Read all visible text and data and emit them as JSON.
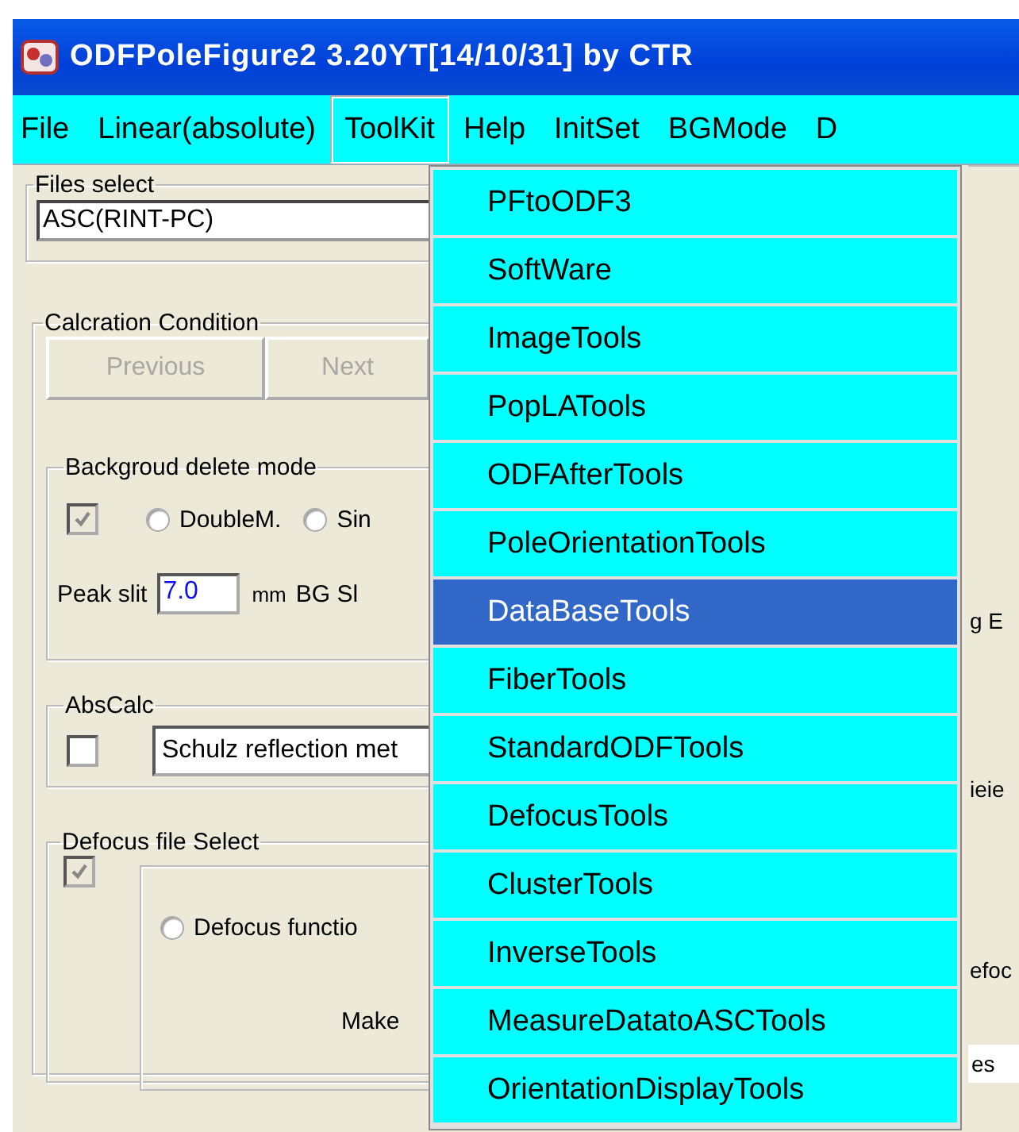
{
  "window": {
    "title": "ODFPoleFigure2 3.20YT[14/10/31] by CTR"
  },
  "menu_bar": [
    {
      "label": "File",
      "selected": false
    },
    {
      "label": "Linear(absolute)",
      "selected": false
    },
    {
      "label": "ToolKit",
      "selected": true
    },
    {
      "label": "Help",
      "selected": false
    },
    {
      "label": "InitSet",
      "selected": false
    },
    {
      "label": "BGMode",
      "selected": false
    },
    {
      "label": "D",
      "selected": false
    }
  ],
  "toolkit_menu": [
    {
      "label": "PFtoODF3",
      "selected": false
    },
    {
      "label": "SoftWare",
      "selected": false
    },
    {
      "label": "ImageTools",
      "selected": false
    },
    {
      "label": "PopLATools",
      "selected": false
    },
    {
      "label": "ODFAfterTools",
      "selected": false
    },
    {
      "label": "PoleOrientationTools",
      "selected": false
    },
    {
      "label": "DataBaseTools",
      "selected": true
    },
    {
      "label": "FiberTools",
      "selected": false
    },
    {
      "label": "StandardODFTools",
      "selected": false
    },
    {
      "label": "DefocusTools",
      "selected": false
    },
    {
      "label": "ClusterTools",
      "selected": false
    },
    {
      "label": "InverseTools",
      "selected": false
    },
    {
      "label": "MeasureDatatoASCTools",
      "selected": false
    },
    {
      "label": "OrientationDisplayTools",
      "selected": false
    }
  ],
  "files_select": {
    "legend": "Files select",
    "value": "ASC(RINT-PC)"
  },
  "calc_condition": {
    "legend": "Calcration Condition",
    "buttons": [
      {
        "label": "Previous",
        "disabled": true
      },
      {
        "label": "Next",
        "disabled": true
      }
    ]
  },
  "background_delete_mode": {
    "legend": "Backgroud delete mode",
    "checkbox": {
      "checked": true,
      "disabled": true
    },
    "options": [
      {
        "label": "DoubleM.",
        "selected": false
      },
      {
        "label": "Sin",
        "selected": false
      }
    ],
    "peak_slit_label": "Peak slit",
    "peak_slit": "7.0",
    "unit": "mm",
    "bg_slit_label": "BG Sl"
  },
  "abs_calc": {
    "legend": "AbsCalc",
    "checkbox": {
      "checked": false,
      "disabled": false
    },
    "method": "Schulz reflection met"
  },
  "defocus_file_select": {
    "legend": "Defocus file Select",
    "checkbox": {
      "checked": true,
      "disabled": true
    },
    "option": {
      "label": "Defocus functio",
      "selected": false
    },
    "make_label": "Make"
  },
  "right_edge": [
    {
      "kind": "text",
      "text": "g  E"
    },
    {
      "kind": "text",
      "text": "ieie"
    },
    {
      "kind": "text",
      "text": "efoc"
    },
    {
      "kind": "field",
      "text": "es"
    }
  ]
}
